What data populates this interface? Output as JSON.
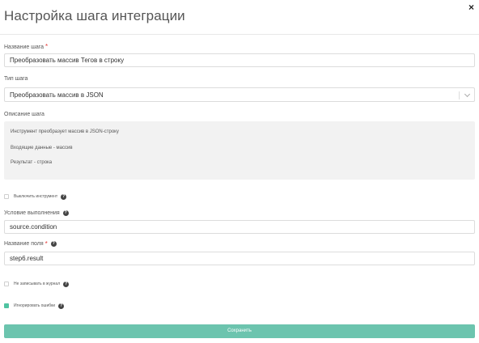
{
  "modal": {
    "title": "Настройка шага интеграции",
    "close_icon": "×"
  },
  "step_name": {
    "label": "Название шага",
    "required_mark": "*",
    "value": "Преобразовать массив Тегов в строку"
  },
  "step_type": {
    "label": "Тип шага",
    "selected": "Преобразовать массив в JSON"
  },
  "description": {
    "label": "Описание шага",
    "lines": [
      "Инструмент преобразует массив в JSON-строку",
      "Входящие данные - массив",
      "Результат - строка"
    ]
  },
  "disable_tool": {
    "label": "Выключить инструмент",
    "checked": false
  },
  "condition": {
    "label": "Условие выполнения",
    "value": "source.condition"
  },
  "field_name": {
    "label": "Название поля",
    "required_mark": "*",
    "value": "step6.result"
  },
  "no_log": {
    "label": "Не записывать в журнал",
    "checked": false
  },
  "ignore_errors": {
    "label": "Игнорировать ошибки",
    "checked": true
  },
  "help_icon": "?",
  "save_label": "Сохранить",
  "colors": {
    "accent": "#6cc4ae",
    "checkbox_checked": "#4fc3a1",
    "required": "#e53935"
  }
}
